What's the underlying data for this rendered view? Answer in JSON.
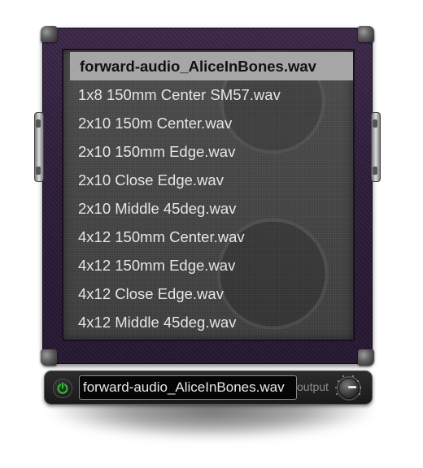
{
  "ir_list": {
    "selected_index": 0,
    "items": [
      "forward-audio_AliceInBones.wav",
      "1x8 150mm Center SM57.wav",
      "2x10 150m Center.wav",
      "2x10 150mm Edge.wav",
      "2x10 Close Edge.wav",
      "2x10 Middle 45deg.wav",
      "4x12 150mm Center.wav",
      "4x12 150mm Edge.wav",
      "4x12 Close Edge.wav",
      "4x12 Middle 45deg.wav"
    ]
  },
  "controls": {
    "power": {
      "icon": "power-icon",
      "state": "on",
      "color": "#2fbf2f"
    },
    "filename": "forward-audio_AliceInBones.wav",
    "output_label": "output",
    "output_knob": {
      "icon": "knob-icon"
    }
  },
  "colors": {
    "cabinet": "#2f1f3c",
    "grille": "#444444",
    "selected_row": "#a6a6a6",
    "power_on": "#2fbf2f"
  }
}
